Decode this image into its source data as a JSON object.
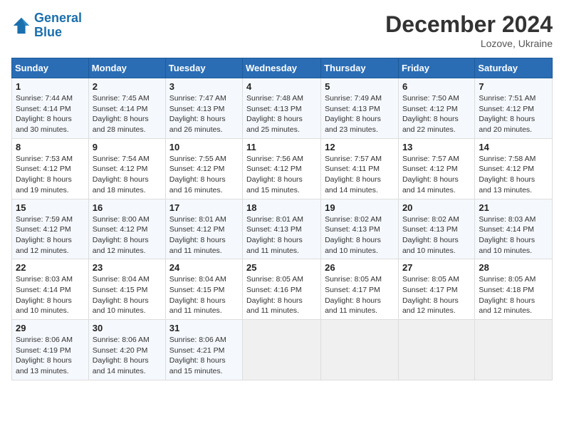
{
  "header": {
    "logo_line1": "General",
    "logo_line2": "Blue",
    "month": "December 2024",
    "location": "Lozove, Ukraine"
  },
  "days_of_week": [
    "Sunday",
    "Monday",
    "Tuesday",
    "Wednesday",
    "Thursday",
    "Friday",
    "Saturday"
  ],
  "weeks": [
    [
      {
        "day": "1",
        "sunrise": "Sunrise: 7:44 AM",
        "sunset": "Sunset: 4:14 PM",
        "daylight": "Daylight: 8 hours and 30 minutes."
      },
      {
        "day": "2",
        "sunrise": "Sunrise: 7:45 AM",
        "sunset": "Sunset: 4:14 PM",
        "daylight": "Daylight: 8 hours and 28 minutes."
      },
      {
        "day": "3",
        "sunrise": "Sunrise: 7:47 AM",
        "sunset": "Sunset: 4:13 PM",
        "daylight": "Daylight: 8 hours and 26 minutes."
      },
      {
        "day": "4",
        "sunrise": "Sunrise: 7:48 AM",
        "sunset": "Sunset: 4:13 PM",
        "daylight": "Daylight: 8 hours and 25 minutes."
      },
      {
        "day": "5",
        "sunrise": "Sunrise: 7:49 AM",
        "sunset": "Sunset: 4:13 PM",
        "daylight": "Daylight: 8 hours and 23 minutes."
      },
      {
        "day": "6",
        "sunrise": "Sunrise: 7:50 AM",
        "sunset": "Sunset: 4:12 PM",
        "daylight": "Daylight: 8 hours and 22 minutes."
      },
      {
        "day": "7",
        "sunrise": "Sunrise: 7:51 AM",
        "sunset": "Sunset: 4:12 PM",
        "daylight": "Daylight: 8 hours and 20 minutes."
      }
    ],
    [
      {
        "day": "8",
        "sunrise": "Sunrise: 7:53 AM",
        "sunset": "Sunset: 4:12 PM",
        "daylight": "Daylight: 8 hours and 19 minutes."
      },
      {
        "day": "9",
        "sunrise": "Sunrise: 7:54 AM",
        "sunset": "Sunset: 4:12 PM",
        "daylight": "Daylight: 8 hours and 18 minutes."
      },
      {
        "day": "10",
        "sunrise": "Sunrise: 7:55 AM",
        "sunset": "Sunset: 4:12 PM",
        "daylight": "Daylight: 8 hours and 16 minutes."
      },
      {
        "day": "11",
        "sunrise": "Sunrise: 7:56 AM",
        "sunset": "Sunset: 4:12 PM",
        "daylight": "Daylight: 8 hours and 15 minutes."
      },
      {
        "day": "12",
        "sunrise": "Sunrise: 7:57 AM",
        "sunset": "Sunset: 4:11 PM",
        "daylight": "Daylight: 8 hours and 14 minutes."
      },
      {
        "day": "13",
        "sunrise": "Sunrise: 7:57 AM",
        "sunset": "Sunset: 4:12 PM",
        "daylight": "Daylight: 8 hours and 14 minutes."
      },
      {
        "day": "14",
        "sunrise": "Sunrise: 7:58 AM",
        "sunset": "Sunset: 4:12 PM",
        "daylight": "Daylight: 8 hours and 13 minutes."
      }
    ],
    [
      {
        "day": "15",
        "sunrise": "Sunrise: 7:59 AM",
        "sunset": "Sunset: 4:12 PM",
        "daylight": "Daylight: 8 hours and 12 minutes."
      },
      {
        "day": "16",
        "sunrise": "Sunrise: 8:00 AM",
        "sunset": "Sunset: 4:12 PM",
        "daylight": "Daylight: 8 hours and 12 minutes."
      },
      {
        "day": "17",
        "sunrise": "Sunrise: 8:01 AM",
        "sunset": "Sunset: 4:12 PM",
        "daylight": "Daylight: 8 hours and 11 minutes."
      },
      {
        "day": "18",
        "sunrise": "Sunrise: 8:01 AM",
        "sunset": "Sunset: 4:13 PM",
        "daylight": "Daylight: 8 hours and 11 minutes."
      },
      {
        "day": "19",
        "sunrise": "Sunrise: 8:02 AM",
        "sunset": "Sunset: 4:13 PM",
        "daylight": "Daylight: 8 hours and 10 minutes."
      },
      {
        "day": "20",
        "sunrise": "Sunrise: 8:02 AM",
        "sunset": "Sunset: 4:13 PM",
        "daylight": "Daylight: 8 hours and 10 minutes."
      },
      {
        "day": "21",
        "sunrise": "Sunrise: 8:03 AM",
        "sunset": "Sunset: 4:14 PM",
        "daylight": "Daylight: 8 hours and 10 minutes."
      }
    ],
    [
      {
        "day": "22",
        "sunrise": "Sunrise: 8:03 AM",
        "sunset": "Sunset: 4:14 PM",
        "daylight": "Daylight: 8 hours and 10 minutes."
      },
      {
        "day": "23",
        "sunrise": "Sunrise: 8:04 AM",
        "sunset": "Sunset: 4:15 PM",
        "daylight": "Daylight: 8 hours and 10 minutes."
      },
      {
        "day": "24",
        "sunrise": "Sunrise: 8:04 AM",
        "sunset": "Sunset: 4:15 PM",
        "daylight": "Daylight: 8 hours and 11 minutes."
      },
      {
        "day": "25",
        "sunrise": "Sunrise: 8:05 AM",
        "sunset": "Sunset: 4:16 PM",
        "daylight": "Daylight: 8 hours and 11 minutes."
      },
      {
        "day": "26",
        "sunrise": "Sunrise: 8:05 AM",
        "sunset": "Sunset: 4:17 PM",
        "daylight": "Daylight: 8 hours and 11 minutes."
      },
      {
        "day": "27",
        "sunrise": "Sunrise: 8:05 AM",
        "sunset": "Sunset: 4:17 PM",
        "daylight": "Daylight: 8 hours and 12 minutes."
      },
      {
        "day": "28",
        "sunrise": "Sunrise: 8:05 AM",
        "sunset": "Sunset: 4:18 PM",
        "daylight": "Daylight: 8 hours and 12 minutes."
      }
    ],
    [
      {
        "day": "29",
        "sunrise": "Sunrise: 8:06 AM",
        "sunset": "Sunset: 4:19 PM",
        "daylight": "Daylight: 8 hours and 13 minutes."
      },
      {
        "day": "30",
        "sunrise": "Sunrise: 8:06 AM",
        "sunset": "Sunset: 4:20 PM",
        "daylight": "Daylight: 8 hours and 14 minutes."
      },
      {
        "day": "31",
        "sunrise": "Sunrise: 8:06 AM",
        "sunset": "Sunset: 4:21 PM",
        "daylight": "Daylight: 8 hours and 15 minutes."
      },
      null,
      null,
      null,
      null
    ]
  ]
}
